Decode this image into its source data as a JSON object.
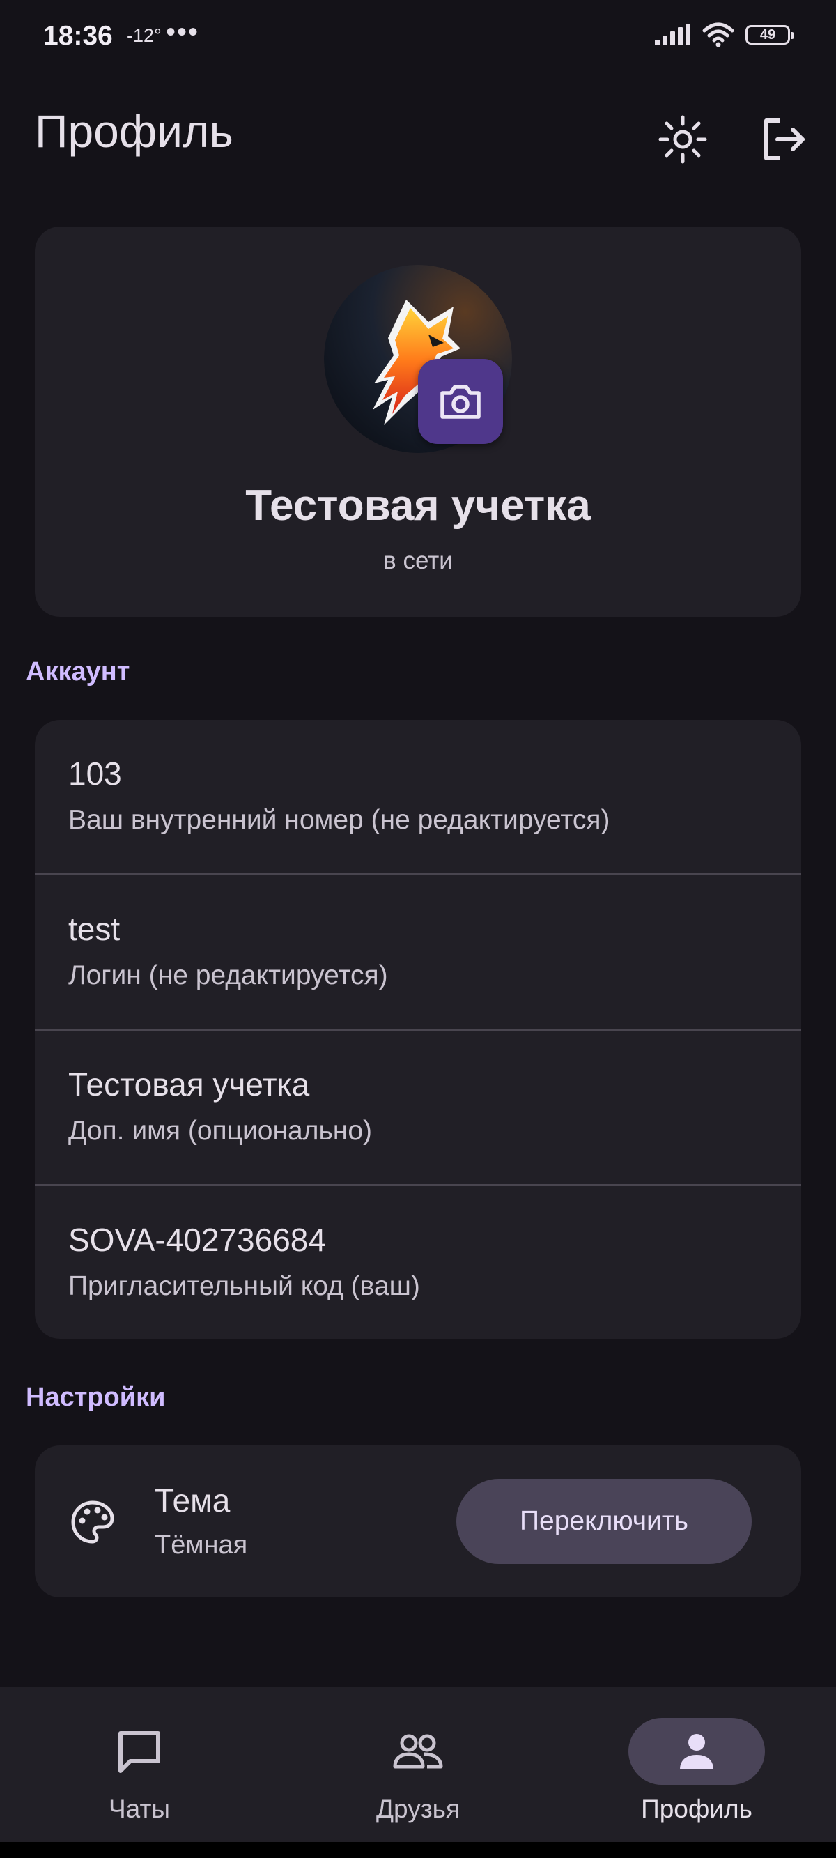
{
  "status_bar": {
    "time": "18:36",
    "temperature": "-12°",
    "more": "•••",
    "battery": "49"
  },
  "header": {
    "title": "Профиль",
    "theme_icon": "sun-icon",
    "logout_icon": "logout-icon"
  },
  "profile": {
    "name": "Тестовая учетка",
    "status": "в сети",
    "camera_icon": "camera-icon"
  },
  "account": {
    "section_title": "Аккаунт",
    "rows": [
      {
        "value": "103",
        "label": "Ваш внутренний номер (не редактируется)"
      },
      {
        "value": "test",
        "label": "Логин (не редактируется)"
      },
      {
        "value": "Тестовая учетка",
        "label": "Доп. имя (опционально)"
      },
      {
        "value": "SOVA-402736684",
        "label": "Пригласительный код (ваш)"
      }
    ]
  },
  "settings": {
    "section_title": "Настройки",
    "theme_label": "Тема",
    "theme_value": "Тёмная",
    "switch_label": "Переключить",
    "palette_icon": "palette-icon"
  },
  "bottom_nav": {
    "items": [
      {
        "label": "Чаты",
        "icon": "chat-icon",
        "active": false
      },
      {
        "label": "Друзья",
        "icon": "friends-icon",
        "active": false
      },
      {
        "label": "Профиль",
        "icon": "profile-icon",
        "active": true
      }
    ]
  },
  "colors": {
    "background": "#141218",
    "surface": "#211F26",
    "accent": "#D0BCFF",
    "camera_button": "#4F378B",
    "tonal_button": "#4A4458"
  }
}
